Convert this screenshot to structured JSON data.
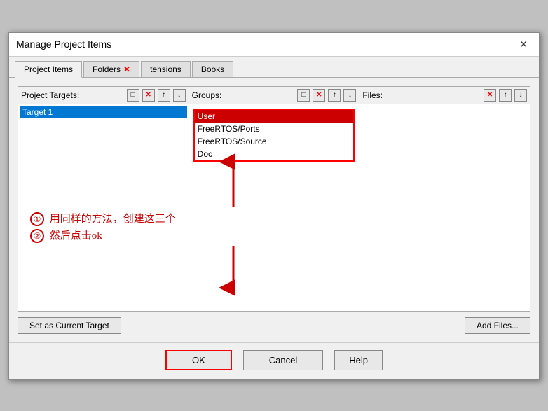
{
  "dialog": {
    "title": "Manage Project Items",
    "close_label": "✕"
  },
  "tabs": [
    {
      "id": "project-items",
      "label": "Project Items",
      "active": true,
      "has_close": false
    },
    {
      "id": "folders",
      "label": "Folders",
      "active": false,
      "has_close": true
    },
    {
      "id": "extensions",
      "label": "tensions",
      "active": false,
      "has_close": false
    },
    {
      "id": "books",
      "label": "Books",
      "active": false,
      "has_close": false
    }
  ],
  "columns": {
    "targets": {
      "label": "Project Targets:",
      "items": [
        {
          "text": "Target 1",
          "selected": true
        }
      ]
    },
    "groups": {
      "label": "Groups:",
      "items": [
        {
          "text": "User",
          "selected": true,
          "highlighted": true
        },
        {
          "text": "FreeRTOS/Ports",
          "selected": false
        },
        {
          "text": "FreeRTOS/Source",
          "selected": false
        },
        {
          "text": "Doc",
          "selected": false
        }
      ]
    },
    "files": {
      "label": "Files:",
      "items": []
    }
  },
  "buttons": {
    "set_current_target": "Set as Current Target",
    "add_files": "Add Files...",
    "ok": "OK",
    "cancel": "Cancel",
    "help": "Help"
  },
  "annotations": {
    "line1_circle": "①",
    "line1_text": " 用同样的方法，创建这三个",
    "line2_circle": "②",
    "line2_text": " 然后点击ok"
  },
  "toolbar_icons": {
    "new": "□",
    "delete": "✕",
    "up": "↑",
    "down": "↓"
  }
}
